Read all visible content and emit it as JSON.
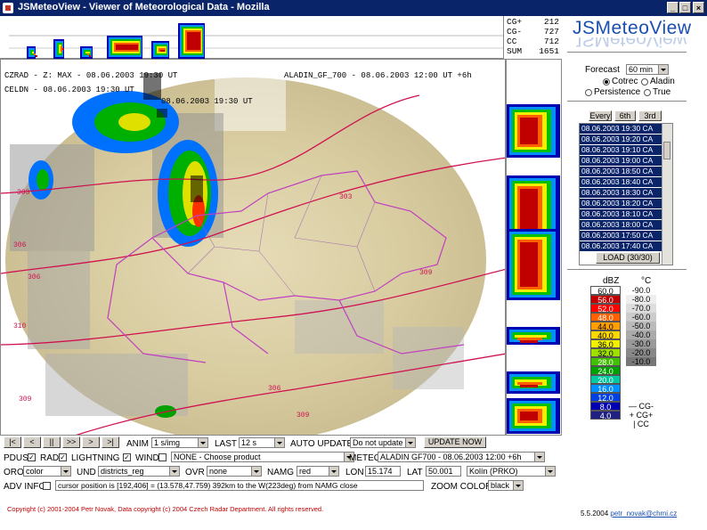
{
  "window": {
    "title": "JSMeteoView - Viewer of Meteorological Data - Mozilla",
    "buttons": {
      "minimize": "_",
      "maximize": "□",
      "close": "×"
    }
  },
  "top_stats": [
    {
      "label": "CG+",
      "value": "212"
    },
    {
      "label": "CG-",
      "value": "727"
    },
    {
      "label": "CC",
      "value": "712"
    },
    {
      "label": "SUM",
      "value": "1651"
    }
  ],
  "map": {
    "overlay_lines": [
      "CZRAD - Z: MAX - 08.06.2003 19:30 UT",
      "CELDN - 08.06.2003 19:30 UT",
      "08.06.2003 19:30 UT"
    ],
    "aladin_label": "ALADIN_GF_700 - 08.06.2003 12:00 UT +6h",
    "contours": [
      "303",
      "306",
      "309",
      "310",
      "306",
      "309",
      "303",
      "306",
      "309"
    ]
  },
  "sidebar": {
    "logo": "JSMeteoView",
    "forecast_label": "Forecast",
    "forecast_value": "60 min",
    "radios": [
      {
        "label": "Cotrec",
        "checked": true
      },
      {
        "label": "Aladin",
        "checked": false
      },
      {
        "label": "Persistence",
        "checked": false
      },
      {
        "label": "True",
        "checked": false
      }
    ],
    "step_buttons": [
      "Every",
      "6th",
      "3rd"
    ],
    "list_items": [
      "08.06.2003 19:30 CA",
      "08.06.2003 19:20 CA",
      "08.06.2003 19:10 CA",
      "08.06.2003 19:00 CA",
      "08.06.2003 18:50 CA",
      "08.06.2003 18:40 CA",
      "08.06.2003 18:30 CA",
      "08.06.2003 18:20 CA",
      "08.06.2003 18:10 CA",
      "08.06.2003 18:00 CA",
      "08.06.2003 17:50 CA",
      "08.06.2003 17:40 CA"
    ],
    "load_button": "LOAD (30/30)",
    "scale_headers": [
      "dBZ",
      "°C"
    ],
    "scale": [
      {
        "dbz": "60.0",
        "temp": "-90.0",
        "color": "#ffffff"
      },
      {
        "dbz": "56.0",
        "temp": "-80.0",
        "color": "#c00000"
      },
      {
        "dbz": "52.0",
        "temp": "-70.0",
        "color": "#ff0000"
      },
      {
        "dbz": "48.0",
        "temp": "-60.0",
        "color": "#ff6000"
      },
      {
        "dbz": "44.0",
        "temp": "-50.0",
        "color": "#ffa000"
      },
      {
        "dbz": "40.0",
        "temp": "-40.0",
        "color": "#ffd800"
      },
      {
        "dbz": "36.0",
        "temp": "-30.0",
        "color": "#f0f000"
      },
      {
        "dbz": "32.0",
        "temp": "-20.0",
        "color": "#a0e000"
      },
      {
        "dbz": "28.0",
        "temp": "-10.0",
        "color": "#40c000"
      },
      {
        "dbz": "24.0",
        "temp": "",
        "color": "#00a000"
      },
      {
        "dbz": "20.0",
        "temp": "",
        "color": "#00c8a0"
      },
      {
        "dbz": "16.0",
        "temp": "",
        "color": "#0090ff"
      },
      {
        "dbz": "12.0",
        "temp": "",
        "color": "#0040e0"
      },
      {
        "dbz": "8.0",
        "temp": "",
        "color": "#0000b0"
      },
      {
        "dbz": "4.0",
        "temp": "",
        "color": "#202080"
      }
    ],
    "temp_greys": [
      "#ffffff",
      "#eeeeee",
      "#dddddd",
      "#cccccc",
      "#bbbbbb",
      "#aaaaaa",
      "#999999",
      "#888888",
      "#777777"
    ],
    "lightning_legend": [
      {
        "symbol": "—",
        "label": "CG-"
      },
      {
        "symbol": "+",
        "label": "CG+"
      },
      {
        "symbol": "|",
        "label": "CC"
      }
    ]
  },
  "controls": {
    "nav_buttons": [
      "|<",
      "<",
      "||",
      ">>",
      ">",
      ">|"
    ],
    "anim_label": "ANIM",
    "anim_value": "1 s/img",
    "last_label": "LAST",
    "last_value": "12 s",
    "auto_update_label": "AUTO UPDATE",
    "auto_update_value": "Do not update",
    "update_now": "UPDATE NOW",
    "row2": {
      "pdus_label": "PDUS",
      "rad_label": "RAD",
      "lightning_label": "LIGHTNING",
      "wind_label": "WIND",
      "none_value": "NONE - Choose product",
      "meteo_label": "METEO",
      "meteo_value": "ALADIN GF700 - 08.06.2003 12:00 +6h"
    },
    "row3": {
      "oro_label": "ORO",
      "oro_value": "color",
      "und_label": "UND",
      "und_value": "districts_reg",
      "ovr_label": "OVR",
      "ovr_value": "none",
      "namg_label": "NAMG",
      "namg_value": "red",
      "lon_label": "LON",
      "lon_value": "15.174",
      "lat_label": "LAT",
      "lat_value": "50.001",
      "place_value": "Kolín (PRKO)"
    },
    "row4": {
      "adv_info_label": "ADV INFO",
      "cursor_text": "cursor position is [192,406] = (13.578,47.759) 392km to the W(223deg) from NAMG close",
      "zoom_label": "ZOOM COLOR",
      "zoom_value": "black"
    }
  },
  "footer": {
    "copyright": "Copyright (c) 2001-2004 Petr Novak, Data copyright (c) 2004 Czech Radar Department. All rights reserved.",
    "date": "5.5.2004",
    "email": "petr_novak@chmi.cz"
  },
  "colors": {
    "titlebar": "#0a246a",
    "terrain": "#d9cfa8",
    "radar_band": [
      "#0000b0",
      "#0090ff",
      "#00c000",
      "#f0f000",
      "#ff6000",
      "#c00000"
    ],
    "borders_purple": "#c040c0",
    "isolines_red": "#d01050"
  }
}
